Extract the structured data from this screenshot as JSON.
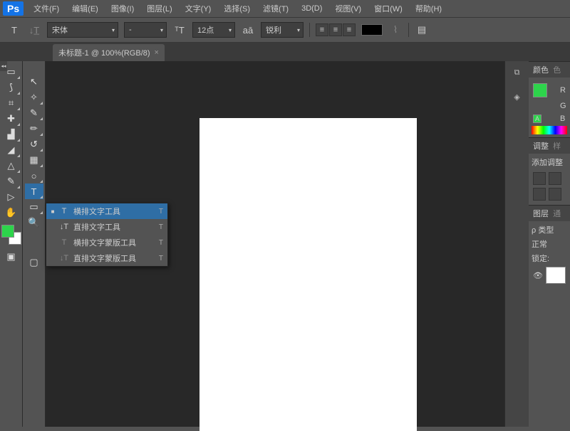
{
  "menu": [
    "文件(F)",
    "编辑(E)",
    "图像(I)",
    "图层(L)",
    "文字(Y)",
    "选择(S)",
    "滤镜(T)",
    "3D(D)",
    "视图(V)",
    "窗口(W)",
    "帮助(H)"
  ],
  "ps_logo": "Ps",
  "options": {
    "font_family": "宋体",
    "font_style": "-",
    "font_size": "12点",
    "aa_label": "aā",
    "aa_mode": "锐利"
  },
  "tab": {
    "title": "未标题-1 @ 100%(RGB/8)",
    "close": "×"
  },
  "flyout": {
    "items": [
      {
        "icon": "T",
        "label": "横排文字工具",
        "key": "T",
        "selected": true
      },
      {
        "icon": "↓T",
        "label": "直排文字工具",
        "key": "T",
        "selected": false
      },
      {
        "icon": "T",
        "label": "横排文字蒙版工具",
        "key": "T",
        "selected": false
      },
      {
        "icon": "↓T",
        "label": "直排文字蒙版工具",
        "key": "T",
        "selected": false
      }
    ]
  },
  "panels": {
    "color_tab": "颜色",
    "color_tab2": "色",
    "r": "R",
    "g": "G",
    "b": "B",
    "adjust": "调整",
    "adjust2": "样",
    "adjust_hint": "添加调整",
    "layers": "图层",
    "layers2": "通",
    "kind": "ρ 类型",
    "blend": "正常",
    "lock": "锁定:"
  },
  "swatch_small": "A"
}
